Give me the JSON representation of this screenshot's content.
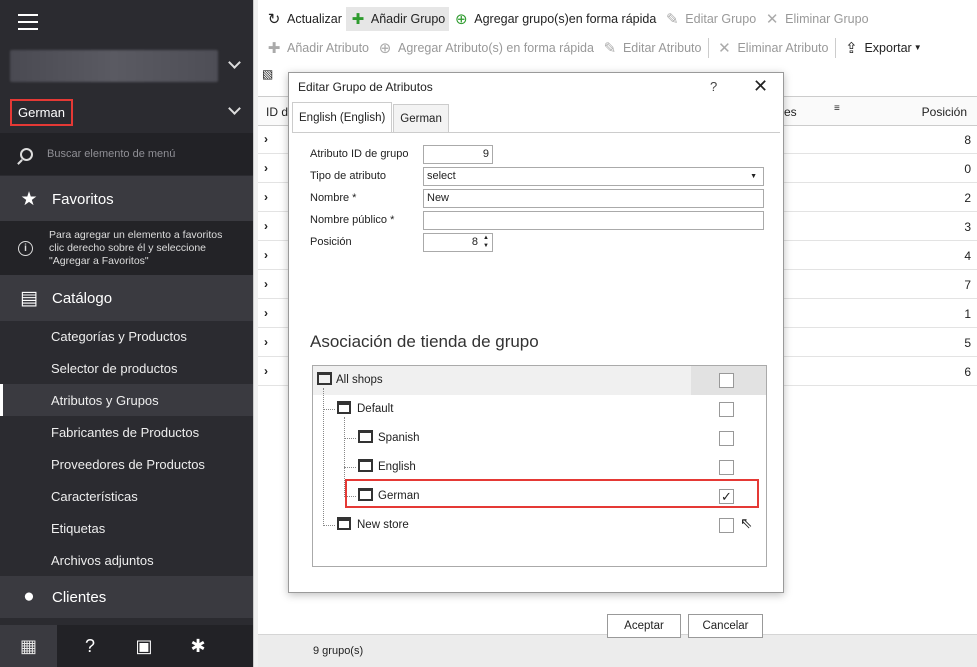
{
  "sidebar": {
    "language": "German",
    "search_placeholder": "Buscar elemento de menú",
    "favorites_label": "Favoritos",
    "favorites_hint_lines": [
      "Para agregar un elemento a favoritos",
      "clic derecho sobre él y seleccione",
      "\"Agregar a Favoritos\""
    ],
    "catalog_label": "Catálogo",
    "catalog_items": [
      "Categorías y Productos",
      "Selector de productos",
      "Atributos y Grupos",
      "Fabricantes de Productos",
      "Proveedores de Productos",
      "Características",
      "Etiquetas",
      "Archivos adjuntos"
    ],
    "clients_label": "Clientes"
  },
  "toolbar1": {
    "refresh": "Actualizar",
    "add_group": "Añadir Grupo",
    "quick_add_group": "Agregar grupo(s)en forma rápida",
    "edit_group": "Editar Grupo",
    "delete_group": "Eliminar Grupo"
  },
  "toolbar2": {
    "add_attr": "Añadir Atributo",
    "quick_add_attr": "Agregar Atributo(s) en forma rápida",
    "edit_attr": "Editar Atributo",
    "delete_attr": "Eliminar Atributo",
    "export": "Exportar"
  },
  "grid": {
    "col_id": "ID d",
    "col_es": "es",
    "col_pos": "Posición",
    "positions": [
      "8",
      "0",
      "2",
      "3",
      "4",
      "7",
      "1",
      "5",
      "6"
    ],
    "status": "9 grupo(s)"
  },
  "dialog": {
    "title": "Editar Grupo de Atributos",
    "help": "?",
    "close": "✕",
    "tabs": [
      "English (English)",
      "German"
    ],
    "fields": {
      "group_id_label": "Atributo ID de grupo",
      "group_id_value": "9",
      "type_label": "Tipo de atributo",
      "type_value": "select",
      "name_label": "Nombre *",
      "name_value": "New",
      "public_name_label": "Nombre público *",
      "public_name_value": "",
      "position_label": "Posición",
      "position_value": "8"
    },
    "association_title": "Asociación de tienda de grupo",
    "tree": [
      {
        "label": "All shops",
        "checked": false
      },
      {
        "label": "Default",
        "checked": false
      },
      {
        "label": "Spanish",
        "checked": false
      },
      {
        "label": "English",
        "checked": false
      },
      {
        "label": "German",
        "checked": true
      },
      {
        "label": "New store",
        "checked": false
      }
    ],
    "ok": "Aceptar",
    "cancel": "Cancelar"
  }
}
